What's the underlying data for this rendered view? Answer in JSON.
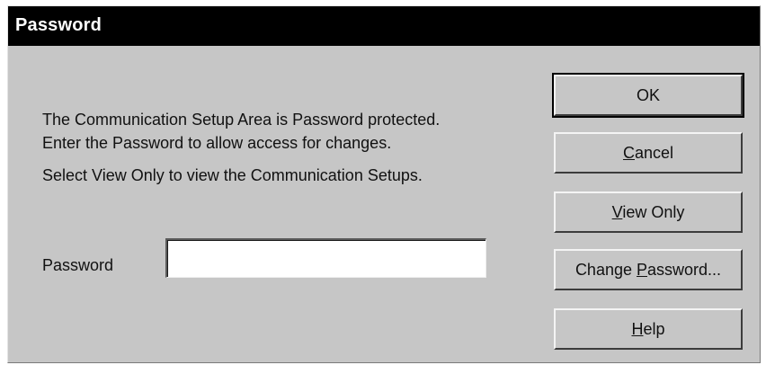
{
  "window": {
    "title": "Password"
  },
  "message": {
    "line1": "The Communication Setup Area is Password protected.",
    "line2": "Enter the Password to allow access for changes.",
    "line3": "Select View Only to view the Communication Setups."
  },
  "password": {
    "label": "Password",
    "value": ""
  },
  "buttons": {
    "ok": "OK",
    "cancel": {
      "mnemonic": "C",
      "rest": "ancel"
    },
    "view_only": {
      "mnemonic": "V",
      "rest": "iew Only"
    },
    "change_password": {
      "pre": "Change ",
      "mnemonic": "P",
      "rest": "assword..."
    },
    "help": {
      "mnemonic": "H",
      "rest": "elp"
    }
  }
}
